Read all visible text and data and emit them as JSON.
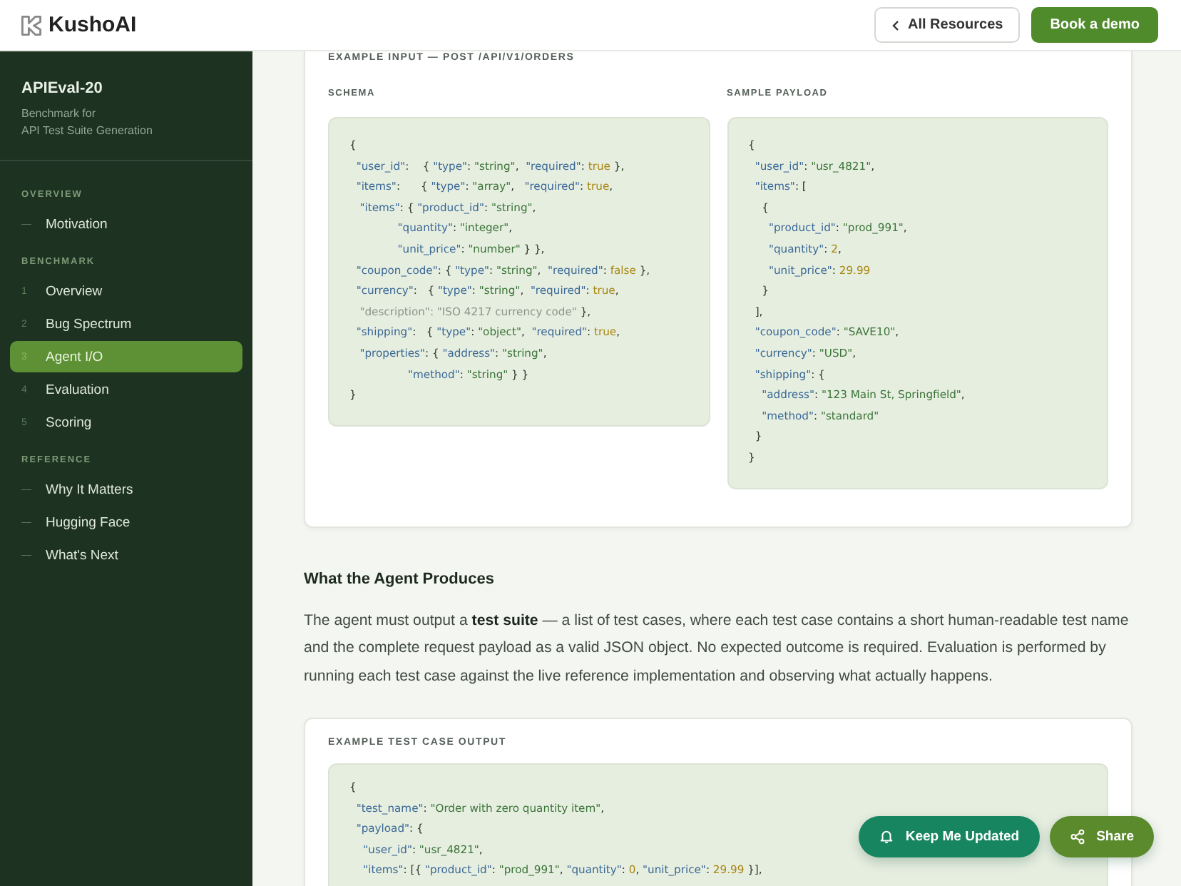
{
  "header": {
    "logo": "KushoAI",
    "buttons": [
      {
        "kind": "back",
        "label": "All Resources"
      },
      {
        "kind": "primary",
        "label": "Book a demo"
      }
    ]
  },
  "sidebar": {
    "title": "APIEval-20",
    "subtitle_lines": [
      "Benchmark for",
      "API Test Suite Generation"
    ],
    "sections": [
      {
        "heading": "OVERVIEW",
        "items": [
          {
            "marker": "—",
            "label": "Motivation",
            "selected": false
          }
        ]
      },
      {
        "heading": "BENCHMARK",
        "items": [
          {
            "marker": "1",
            "label": "Overview",
            "selected": false
          },
          {
            "marker": "2",
            "label": "Bug Spectrum",
            "selected": false
          },
          {
            "marker": "3",
            "label": "Agent I/O",
            "selected": true
          },
          {
            "marker": "4",
            "label": "Evaluation",
            "selected": false
          },
          {
            "marker": "5",
            "label": "Scoring",
            "selected": false
          }
        ]
      },
      {
        "heading": "REFERENCE",
        "items": [
          {
            "marker": "—",
            "label": "Why It Matters",
            "selected": false
          },
          {
            "marker": "—",
            "label": "Hugging Face",
            "selected": false
          },
          {
            "marker": "—",
            "label": "What's Next",
            "selected": false
          }
        ]
      }
    ]
  },
  "input_card": {
    "label": "EXAMPLE INPUT — POST /API/V1/ORDERS",
    "panels": [
      {
        "label": "SCHEMA",
        "lines": [
          [
            {
              "kind": "p",
              "text": "{"
            }
          ],
          [
            {
              "kind": "k",
              "text": "  \"user_id\""
            },
            {
              "kind": "p",
              "text": ":    { "
            },
            {
              "kind": "k",
              "text": "\"type\""
            },
            {
              "kind": "p",
              "text": ": "
            },
            {
              "kind": "s",
              "text": "\"string\""
            },
            {
              "kind": "p",
              "text": ",  "
            },
            {
              "kind": "k",
              "text": "\"required\""
            },
            {
              "kind": "p",
              "text": ": "
            },
            {
              "kind": "l",
              "text": "true"
            },
            {
              "kind": "p",
              "text": " },"
            }
          ],
          [
            {
              "kind": "k",
              "text": "  \"items\""
            },
            {
              "kind": "p",
              "text": ":      { "
            },
            {
              "kind": "k",
              "text": "\"type\""
            },
            {
              "kind": "p",
              "text": ": "
            },
            {
              "kind": "s",
              "text": "\"array\""
            },
            {
              "kind": "p",
              "text": ",   "
            },
            {
              "kind": "k",
              "text": "\"required\""
            },
            {
              "kind": "p",
              "text": ": "
            },
            {
              "kind": "l",
              "text": "true"
            },
            {
              "kind": "p",
              "text": ","
            }
          ],
          [
            {
              "kind": "k",
              "text": "   \"items\""
            },
            {
              "kind": "p",
              "text": ": { "
            },
            {
              "kind": "k",
              "text": "\"product_id\""
            },
            {
              "kind": "p",
              "text": ": "
            },
            {
              "kind": "s",
              "text": "\"string\""
            },
            {
              "kind": "p",
              "text": ","
            }
          ],
          [
            {
              "kind": "k",
              "text": "              \"quantity\""
            },
            {
              "kind": "p",
              "text": ": "
            },
            {
              "kind": "s",
              "text": "\"integer\""
            },
            {
              "kind": "p",
              "text": ","
            }
          ],
          [
            {
              "kind": "k",
              "text": "              \"unit_price\""
            },
            {
              "kind": "p",
              "text": ": "
            },
            {
              "kind": "s",
              "text": "\"number\""
            },
            {
              "kind": "p",
              "text": " } },"
            }
          ],
          [
            {
              "kind": "k",
              "text": "  \"coupon_code\""
            },
            {
              "kind": "p",
              "text": ": { "
            },
            {
              "kind": "k",
              "text": "\"type\""
            },
            {
              "kind": "p",
              "text": ": "
            },
            {
              "kind": "s",
              "text": "\"string\""
            },
            {
              "kind": "p",
              "text": ",  "
            },
            {
              "kind": "k",
              "text": "\"required\""
            },
            {
              "kind": "p",
              "text": ": "
            },
            {
              "kind": "l",
              "text": "false"
            },
            {
              "kind": "p",
              "text": " },"
            }
          ],
          [
            {
              "kind": "k",
              "text": "  \"currency\""
            },
            {
              "kind": "p",
              "text": ":   { "
            },
            {
              "kind": "k",
              "text": "\"type\""
            },
            {
              "kind": "p",
              "text": ": "
            },
            {
              "kind": "s",
              "text": "\"string\""
            },
            {
              "kind": "p",
              "text": ",  "
            },
            {
              "kind": "k",
              "text": "\"required\""
            },
            {
              "kind": "p",
              "text": ": "
            },
            {
              "kind": "l",
              "text": "true"
            },
            {
              "kind": "p",
              "text": ","
            }
          ],
          [
            {
              "kind": "m",
              "text": "   \"description\": \"ISO 4217 currency code\""
            },
            {
              "kind": "p",
              "text": " },"
            }
          ],
          [
            {
              "kind": "k",
              "text": "  \"shipping\""
            },
            {
              "kind": "p",
              "text": ":   { "
            },
            {
              "kind": "k",
              "text": "\"type\""
            },
            {
              "kind": "p",
              "text": ": "
            },
            {
              "kind": "s",
              "text": "\"object\""
            },
            {
              "kind": "p",
              "text": ",  "
            },
            {
              "kind": "k",
              "text": "\"required\""
            },
            {
              "kind": "p",
              "text": ": "
            },
            {
              "kind": "l",
              "text": "true"
            },
            {
              "kind": "p",
              "text": ","
            }
          ],
          [
            {
              "kind": "k",
              "text": "   \"properties\""
            },
            {
              "kind": "p",
              "text": ": { "
            },
            {
              "kind": "k",
              "text": "\"address\""
            },
            {
              "kind": "p",
              "text": ": "
            },
            {
              "kind": "s",
              "text": "\"string\""
            },
            {
              "kind": "p",
              "text": ","
            }
          ],
          [
            {
              "kind": "k",
              "text": "                 \"method\""
            },
            {
              "kind": "p",
              "text": ": "
            },
            {
              "kind": "s",
              "text": "\"string\""
            },
            {
              "kind": "p",
              "text": " } }"
            }
          ],
          [
            {
              "kind": "p",
              "text": "}"
            }
          ]
        ]
      },
      {
        "label": "SAMPLE PAYLOAD",
        "lines": [
          [
            {
              "kind": "p",
              "text": "{"
            }
          ],
          [
            {
              "kind": "k",
              "text": "  \"user_id\""
            },
            {
              "kind": "p",
              "text": ": "
            },
            {
              "kind": "s",
              "text": "\"usr_4821\""
            },
            {
              "kind": "p",
              "text": ","
            }
          ],
          [
            {
              "kind": "k",
              "text": "  \"items\""
            },
            {
              "kind": "p",
              "text": ": ["
            }
          ],
          [
            {
              "kind": "p",
              "text": "    {"
            }
          ],
          [
            {
              "kind": "k",
              "text": "      \"product_id\""
            },
            {
              "kind": "p",
              "text": ": "
            },
            {
              "kind": "s",
              "text": "\"prod_991\""
            },
            {
              "kind": "p",
              "text": ","
            }
          ],
          [
            {
              "kind": "k",
              "text": "      \"quantity\""
            },
            {
              "kind": "p",
              "text": ": "
            },
            {
              "kind": "l",
              "text": "2"
            },
            {
              "kind": "p",
              "text": ","
            }
          ],
          [
            {
              "kind": "k",
              "text": "      \"unit_price\""
            },
            {
              "kind": "p",
              "text": ": "
            },
            {
              "kind": "l",
              "text": "29.99"
            }
          ],
          [
            {
              "kind": "p",
              "text": "    }"
            }
          ],
          [
            {
              "kind": "p",
              "text": "  ],"
            }
          ],
          [
            {
              "kind": "k",
              "text": "  \"coupon_code\""
            },
            {
              "kind": "p",
              "text": ": "
            },
            {
              "kind": "s",
              "text": "\"SAVE10\""
            },
            {
              "kind": "p",
              "text": ","
            }
          ],
          [
            {
              "kind": "k",
              "text": "  \"currency\""
            },
            {
              "kind": "p",
              "text": ": "
            },
            {
              "kind": "s",
              "text": "\"USD\""
            },
            {
              "kind": "p",
              "text": ","
            }
          ],
          [
            {
              "kind": "k",
              "text": "  \"shipping\""
            },
            {
              "kind": "p",
              "text": ": {"
            }
          ],
          [
            {
              "kind": "k",
              "text": "    \"address\""
            },
            {
              "kind": "p",
              "text": ": "
            },
            {
              "kind": "s",
              "text": "\"123 Main St, Springfield\""
            },
            {
              "kind": "p",
              "text": ","
            }
          ],
          [
            {
              "kind": "k",
              "text": "    \"method\""
            },
            {
              "kind": "p",
              "text": ": "
            },
            {
              "kind": "s",
              "text": "\"standard\""
            }
          ],
          [
            {
              "kind": "p",
              "text": "  }"
            }
          ],
          [
            {
              "kind": "p",
              "text": "}"
            }
          ]
        ]
      }
    ]
  },
  "section": {
    "heading": "What the Agent Produces",
    "paragraph": "The agent must output a **test suite** — a list of test cases, where each test case contains a short human-readable test name and the complete request payload as a valid JSON object. No expected outcome is required. Evaluation is performed by running each test case against the live reference implementation and observing what actually happens."
  },
  "output_card": {
    "label": "EXAMPLE TEST CASE OUTPUT",
    "lines": [
      [
        {
          "kind": "p",
          "text": "{"
        }
      ],
      [
        {
          "kind": "k",
          "text": "  \"test_name\""
        },
        {
          "kind": "p",
          "text": ": "
        },
        {
          "kind": "s",
          "text": "\"Order with zero quantity item\""
        },
        {
          "kind": "p",
          "text": ","
        }
      ],
      [
        {
          "kind": "k",
          "text": "  \"payload\""
        },
        {
          "kind": "p",
          "text": ": {"
        }
      ],
      [
        {
          "kind": "k",
          "text": "    \"user_id\""
        },
        {
          "kind": "p",
          "text": ": "
        },
        {
          "kind": "s",
          "text": "\"usr_4821\""
        },
        {
          "kind": "p",
          "text": ","
        }
      ],
      [
        {
          "kind": "k",
          "text": "    \"items\""
        },
        {
          "kind": "p",
          "text": ": [{ "
        },
        {
          "kind": "k",
          "text": "\"product_id\""
        },
        {
          "kind": "p",
          "text": ": "
        },
        {
          "kind": "s",
          "text": "\"prod_991\""
        },
        {
          "kind": "p",
          "text": ", "
        },
        {
          "kind": "k",
          "text": "\"quantity\""
        },
        {
          "kind": "p",
          "text": ": "
        },
        {
          "kind": "l",
          "text": "0"
        },
        {
          "kind": "p",
          "text": ", "
        },
        {
          "kind": "k",
          "text": "\"unit_price\""
        },
        {
          "kind": "p",
          "text": ": "
        },
        {
          "kind": "l",
          "text": "29.99"
        },
        {
          "kind": "p",
          "text": " }],"
        }
      ]
    ]
  },
  "floating_buttons": [
    {
      "kind": "notify",
      "label": "Keep Me Updated"
    },
    {
      "kind": "share",
      "label": "Share"
    }
  ]
}
